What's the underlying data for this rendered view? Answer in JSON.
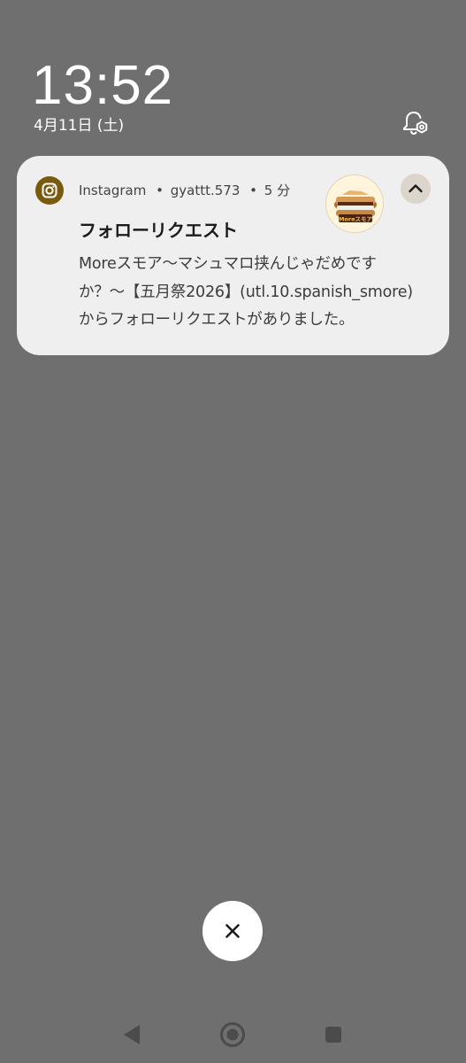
{
  "lockscreen": {
    "time": "13:52",
    "date": "4月11日 (土)"
  },
  "notification": {
    "app_name": "Instagram",
    "separator": "•",
    "account": "gyattt.573",
    "age": "5 分",
    "title": "フォローリクエスト",
    "body_line1": "Moreスモア〜マシュマロ挟んじゃだめです",
    "body_line2": "か？〜【五月祭2026】(utl.10.spanish_smore)",
    "body_line3": "からフォローリクエストがありました。",
    "avatar_logo_text": "Moreスモア",
    "app_icon_color": "#7a5a0f"
  },
  "icons": {
    "dnd": "bell-settings-icon",
    "app": "instagram-icon",
    "expand": "chevron-up-icon",
    "dismiss": "close-icon",
    "back": "back-triangle-icon",
    "home": "home-circle-icon",
    "recents": "recents-square-icon"
  }
}
